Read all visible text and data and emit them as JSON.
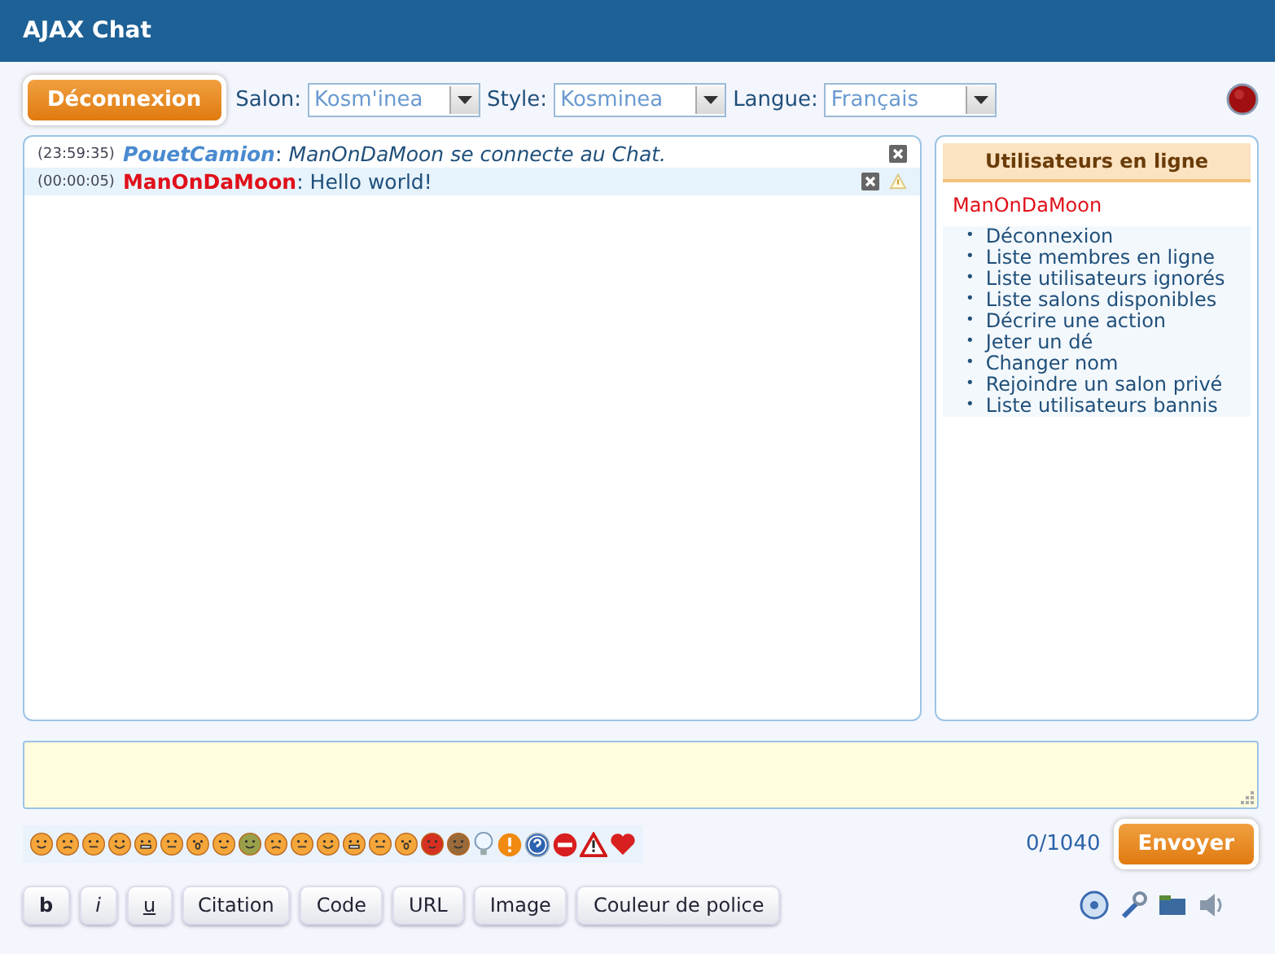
{
  "window": {
    "title": "AJAX Chat"
  },
  "toolbar": {
    "logout_button": "Déconnexion",
    "selects": [
      {
        "label": "Salon:",
        "value": "Kosm'inea"
      },
      {
        "label": "Style:",
        "value": "Kosminea"
      },
      {
        "label": "Langue:",
        "value": "Français"
      }
    ]
  },
  "messages": [
    {
      "time": "(23:59:35)",
      "user": "PouetCamion",
      "separator": ":",
      "text": "ManOnDaMoon se connecte au Chat.",
      "kind": "system"
    },
    {
      "time": "(00:00:05)",
      "user": "ManOnDaMoon",
      "separator": ":",
      "text": "Hello world!",
      "kind": "user"
    }
  ],
  "online_users": {
    "title": "Utilisateurs en ligne",
    "users": [
      "ManOnDaMoon"
    ],
    "bullet": "•",
    "commands": [
      "Déconnexion",
      "Liste membres en ligne",
      "Liste utilisateurs ignorés",
      "Liste salons disponibles",
      "Décrire une action",
      "Jeter un dé",
      "Changer nom",
      "Rejoindre un salon privé",
      "Liste utilisateurs bannis"
    ]
  },
  "composer": {
    "counter": "0/1040",
    "send_button": "Envoyer"
  },
  "format_buttons": [
    {
      "label": "b",
      "kind": "bold"
    },
    {
      "label": "i",
      "kind": "italic"
    },
    {
      "label": "u",
      "kind": "underline"
    },
    {
      "label": "Citation",
      "kind": "plain"
    },
    {
      "label": "Code",
      "kind": "plain"
    },
    {
      "label": "URL",
      "kind": "plain"
    },
    {
      "label": "Image",
      "kind": "plain"
    },
    {
      "label": "Couleur de police",
      "kind": "plain"
    }
  ]
}
